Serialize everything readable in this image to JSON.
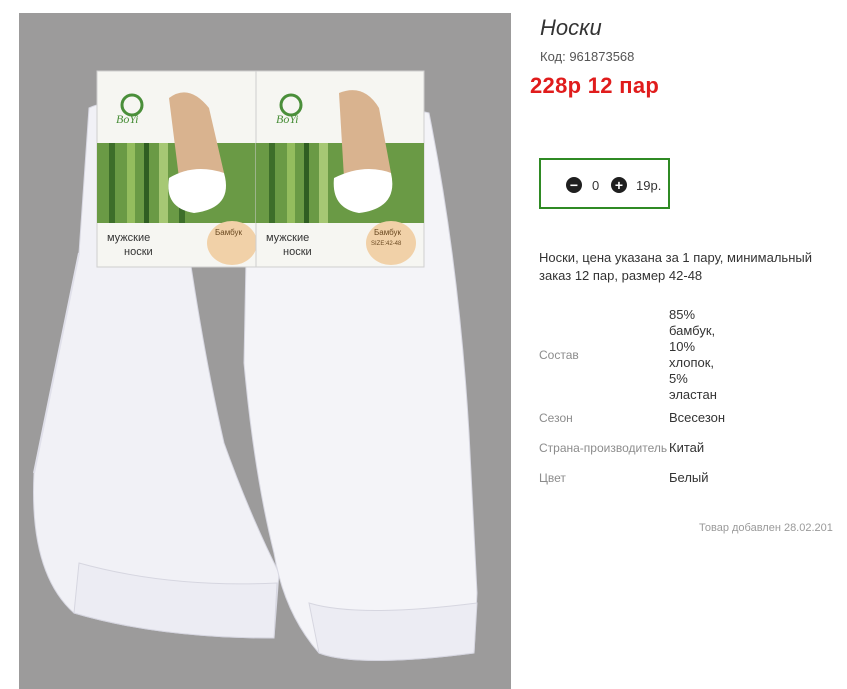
{
  "product": {
    "title": "Носки",
    "code_label": "Код: 961873568",
    "price": "228р  12 пар",
    "photo_alt": "Белые носки BoYi",
    "package_brand": "BoYi",
    "package_label_line1": "мужские",
    "package_label_line2": "носки",
    "package_material": "Бамбук",
    "package_size": "SIZE:42-48"
  },
  "quantity": {
    "minus_icon": "minus-circle-icon",
    "plus_icon": "plus-circle-icon",
    "value": "0",
    "unit_price": "19р."
  },
  "description": "Носки, цена указана за 1 пару, минимальный заказ 12 пар, размер 42-48",
  "specs": [
    {
      "key": "Состав",
      "value": "85% бамбук, 10% хлопок, 5% эластан"
    },
    {
      "key": "Сезон",
      "value": "Всесезон"
    },
    {
      "key": "Страна-производитель",
      "value": "Китай"
    },
    {
      "key": "Цвет",
      "value": "Белый"
    }
  ],
  "added_text": "Товар добавлен 28.02.201",
  "colors": {
    "price": "#e01c1c",
    "qty_border": "#2f8a24",
    "photo_bg": "#9c9b9b"
  }
}
